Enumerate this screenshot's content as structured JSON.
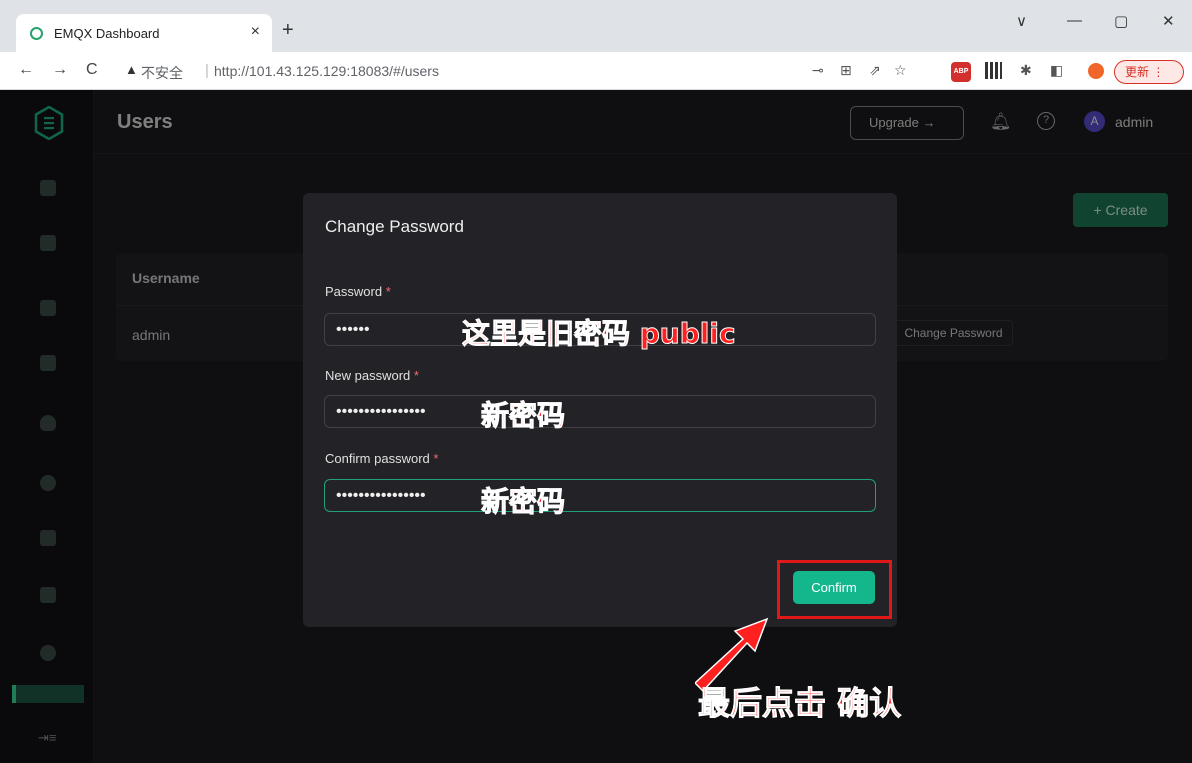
{
  "browser": {
    "tab_title": "EMQX Dashboard",
    "tab_close": "×",
    "new_tab": "+",
    "window_controls": [
      "∨",
      "—",
      "▢",
      "✕"
    ],
    "nav": [
      "←",
      "→",
      "C"
    ],
    "security_warning": "不安全",
    "url": "http://101.43.125.129:18083/#/users",
    "update_label": "更新 ⋮"
  },
  "header": {
    "page_title": "Users",
    "upgrade_label": "Upgrade →",
    "avatar_letter": "A",
    "user_name": "admin"
  },
  "main": {
    "create_label": "+ Create",
    "table": {
      "column_username": "Username",
      "rows": [
        {
          "username": "admin",
          "action": "Change Password"
        }
      ]
    }
  },
  "modal": {
    "title": "Change Password",
    "fields": [
      {
        "label": "Password",
        "value": "••••••"
      },
      {
        "label": "New password",
        "value": "••••••••••••••••"
      },
      {
        "label": "Confirm password",
        "value": "••••••••••••••••"
      }
    ],
    "confirm_label": "Confirm"
  },
  "annotations": {
    "old_password_note": "这里是旧密码 public",
    "new_password_note": "新密码",
    "confirm_password_note": "新密码",
    "final_click_note": "最后点击 确认",
    "color": "#ff2020"
  }
}
